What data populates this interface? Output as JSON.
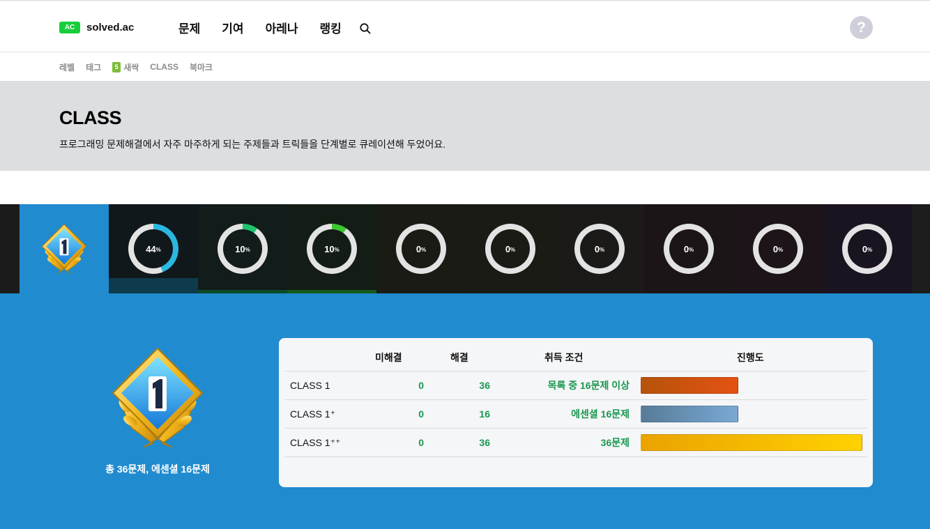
{
  "nav": {
    "logo_badge": "AC",
    "logo_text": "solved.ac",
    "items": [
      {
        "label": "문제"
      },
      {
        "label": "기여"
      },
      {
        "label": "아레나"
      },
      {
        "label": "랭킹"
      }
    ],
    "help_label": "?"
  },
  "subnav": {
    "items": [
      {
        "label": "레벨"
      },
      {
        "label": "태그"
      },
      {
        "label": "새싹",
        "badge": "5"
      },
      {
        "label": "CLASS"
      },
      {
        "label": "북마크"
      }
    ]
  },
  "hero": {
    "title": "CLASS",
    "description": "프로그래밍 문제해결에서 자주 마주하게 되는 주제들과 트릭들을 단계별로 큐레이션해 두었어요."
  },
  "class_tiles": [
    {
      "class": "1",
      "selected": true
    },
    {
      "percent": "44",
      "progress": 0.44,
      "color": "#2bb8e0",
      "tile_bg": "#11181c",
      "bar_color": "#0d3b4c"
    },
    {
      "percent": "10",
      "progress": 0.1,
      "color": "#21c46d",
      "tile_bg": "#121c1a",
      "bar_color": "#0c4a2a"
    },
    {
      "percent": "10",
      "progress": 0.1,
      "color": "#3cc832",
      "tile_bg": "#141c16",
      "bar_color": "#145a1b"
    },
    {
      "percent": "0",
      "progress": 0,
      "color": "#e5e5e5",
      "tile_bg": "#1a1b14"
    },
    {
      "percent": "0",
      "progress": 0,
      "color": "#e5e5e5",
      "tile_bg": "#1b1b16"
    },
    {
      "percent": "0",
      "progress": 0,
      "color": "#e5e5e5",
      "tile_bg": "#1b1a18"
    },
    {
      "percent": "0",
      "progress": 0,
      "color": "#e5e5e5",
      "tile_bg": "#1c1517"
    },
    {
      "percent": "0",
      "progress": 0,
      "color": "#e5e5e5",
      "tile_bg": "#1c1419"
    },
    {
      "percent": "0",
      "progress": 0,
      "color": "#e5e5e5",
      "tile_bg": "#1a1320"
    }
  ],
  "percent_unit": "%",
  "detail": {
    "badge_number": "1",
    "caption": "총 36문제, 에센셜 16문제",
    "headers": {
      "unsolved": "미해결",
      "solved": "해결",
      "condition": "취득 조건",
      "progress": "진행도"
    },
    "rows": [
      {
        "name": "CLASS 1",
        "unsolved": "0",
        "solved": "36",
        "condition": "목록 중 16문제 이상",
        "progress": 0.44,
        "bar_gradient": "linear-gradient(90deg,#b5530a,#e55212)"
      },
      {
        "name": "CLASS 1⁺",
        "unsolved": "0",
        "solved": "16",
        "condition": "에센셜 16문제",
        "progress": 0.44,
        "bar_gradient": "linear-gradient(90deg,#577b98,#7aa9d4)"
      },
      {
        "name": "CLASS 1⁺⁺",
        "unsolved": "0",
        "solved": "36",
        "condition": "36문제",
        "progress": 1.0,
        "bar_gradient": "linear-gradient(90deg,#eba300,#ffd200)"
      }
    ]
  },
  "colors": {
    "accent_blue": "#218bcf",
    "green_text": "#1a9850",
    "hero_bg": "#dddee0"
  }
}
